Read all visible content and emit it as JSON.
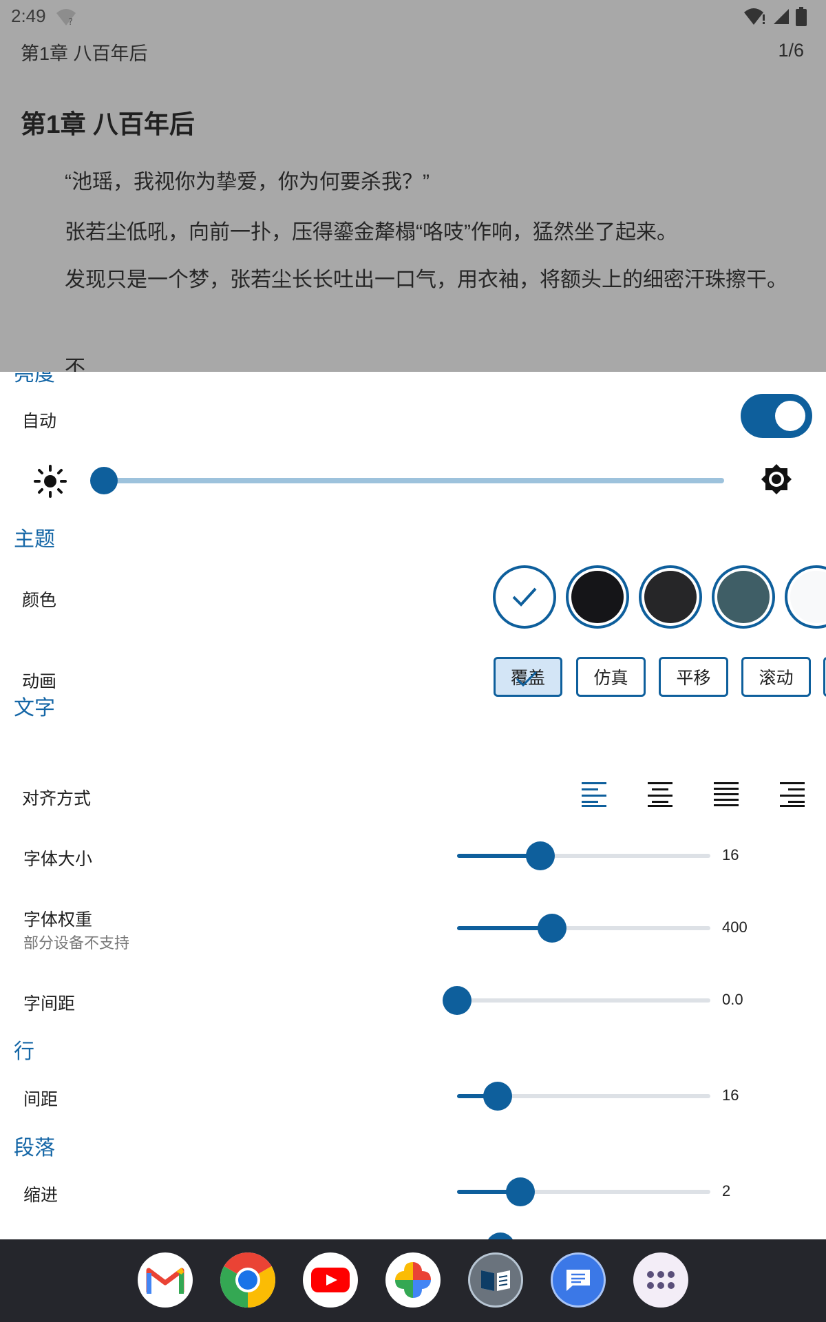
{
  "status": {
    "time": "2:49"
  },
  "reader": {
    "header_title": "第1章 八百年后",
    "page_indicator": "1/6",
    "chapter_title": "第1章 八百年后",
    "paragraphs": [
      "“池瑶，我视你为挚爱，你为何要杀我？”",
      "张若尘低吼，向前一扑，压得鎏金犛榻“咯吱”作响，猛然坐了起来。",
      "发现只是一个梦，张若尘长长吐出一口气，用衣袖，将额头上的细密汗珠擦干。",
      "不……"
    ]
  },
  "settings": {
    "brightness": {
      "section_label_partial": "亮度",
      "auto_label": "自动",
      "auto_enabled": true,
      "level": 0.0
    },
    "theme": {
      "section_label": "主题",
      "color_label": "颜色",
      "colors": [
        "#ffffff",
        "#151518",
        "#262628",
        "#3f5e66",
        "#f8f9fa"
      ],
      "selected_color_index": 0,
      "animation_label": "动画",
      "animations": [
        "覆盖",
        "仿真",
        "平移",
        "滚动"
      ],
      "selected_animation_index": 0
    },
    "text": {
      "section_label": "文字",
      "align_label": "对齐方式",
      "selected_align_index": 0,
      "font_size_label": "字体大小",
      "font_size_value": "16",
      "font_size_fraction": 0.33,
      "font_weight_label": "字体权重",
      "font_weight_note": "部分设备不支持",
      "font_weight_value": "400",
      "font_weight_fraction": 0.375,
      "letter_spacing_label": "字间距",
      "letter_spacing_value": "0.0",
      "letter_spacing_fraction": 0.0
    },
    "line": {
      "section_label": "行",
      "spacing_label": "间距",
      "spacing_value": "16",
      "spacing_fraction": 0.16
    },
    "paragraph": {
      "section_label": "段落",
      "indent_label": "缩进",
      "indent_value": "2",
      "indent_fraction": 0.25
    }
  },
  "dock": {
    "apps": [
      "gmail-icon",
      "chrome-icon",
      "youtube-icon",
      "photos-icon",
      "reader-app-icon",
      "messages-icon",
      "app-drawer-icon"
    ]
  }
}
